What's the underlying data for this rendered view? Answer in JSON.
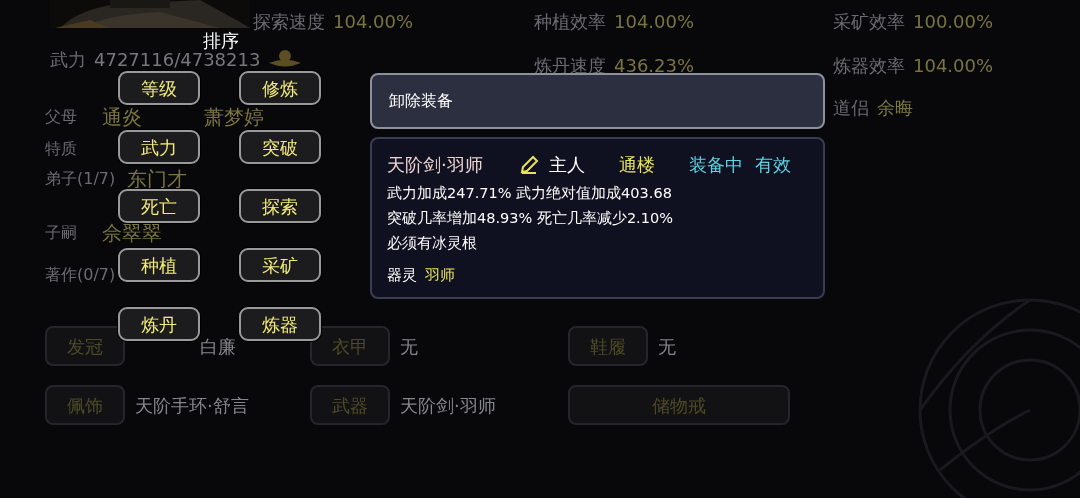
{
  "stats": [
    {
      "label": "探索速度",
      "value": "104.00%"
    },
    {
      "label": "种植效率",
      "value": "104.00%"
    },
    {
      "label": "采矿效率",
      "value": "100.00%"
    },
    {
      "label": "炼丹速度",
      "value": "436.23%"
    },
    {
      "label": "炼器效率",
      "value": "104.00%"
    }
  ],
  "power": {
    "label": "武力",
    "value": "4727116/4738213"
  },
  "spouse": {
    "label": "道侣",
    "value": "余晦"
  },
  "info_rows": [
    {
      "label": "父母",
      "values": [
        "通炎",
        "萧梦婷"
      ]
    },
    {
      "label": "特质"
    },
    {
      "label": "弟子(1/7)",
      "values": [
        "东门才"
      ]
    },
    {
      "label": "子嗣",
      "values": [
        "佘翠翠"
      ]
    },
    {
      "label": "著作(0/7)"
    }
  ],
  "slots": [
    {
      "label": "发冠",
      "item": "白廉"
    },
    {
      "label": "衣甲",
      "item": "无"
    },
    {
      "label": "鞋履",
      "item": "无"
    },
    {
      "label": "佩饰",
      "item": "天阶手环·舒言"
    },
    {
      "label": "武器",
      "item": "天阶剑·羽师"
    },
    {
      "label": "储物戒",
      "kind": "wide"
    }
  ],
  "sort_menu": {
    "title": "排序",
    "options": [
      "等级",
      "修炼",
      "武力",
      "突破",
      "死亡",
      "探索",
      "种植",
      "采矿",
      "炼丹",
      "炼器"
    ]
  },
  "unequip_button": "卸除装备",
  "item_card": {
    "name": "天阶剑·羽师",
    "owner": "主人",
    "location": "通楼",
    "status": "装备中",
    "validity": "有效",
    "effects": [
      "武力加成247.71% 武力绝对值加成403.68",
      "突破几率增加48.93% 死亡几率减少2.10%",
      "必须有冰灵根"
    ],
    "spirit_label": "器灵",
    "spirit": "羽师"
  }
}
